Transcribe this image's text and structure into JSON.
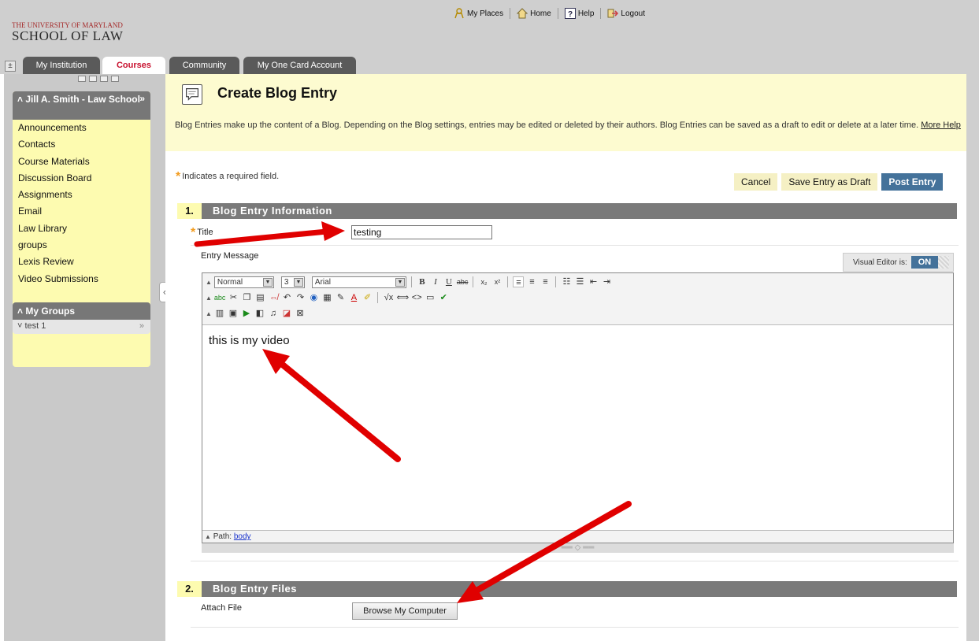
{
  "header": {
    "logo_line1": "THE UNIVERSITY of MARYLAND",
    "logo_line2": "SCHOOL OF LAW",
    "top_links": [
      {
        "label": "My Places",
        "icon": "places-icon"
      },
      {
        "label": "Home",
        "icon": "home-icon"
      },
      {
        "label": "Help",
        "icon": "help-icon"
      },
      {
        "label": "Logout",
        "icon": "logout-icon"
      }
    ],
    "tabs": [
      {
        "label": "My Institution",
        "active": false
      },
      {
        "label": "Courses",
        "active": true
      },
      {
        "label": "Community",
        "active": false
      },
      {
        "label": "My One Card Account",
        "active": false
      }
    ]
  },
  "sidebar": {
    "course_title": "Jill A. Smith - Law School",
    "items": [
      "Announcements",
      "Contacts",
      "Course Materials",
      "Discussion Board",
      "Assignments",
      "Email",
      "Law Library",
      "groups",
      "Lexis Review",
      "Video Submissions"
    ],
    "groups_title": "My Groups",
    "groups": [
      "test 1"
    ]
  },
  "page": {
    "title": "Create Blog Entry",
    "description": "Blog Entries make up the content of a Blog. Depending on the Blog settings, entries may be edited or deleted by their authors. Blog Entries can be saved as a draft to edit or delete at a later time.",
    "help_link": "More Help",
    "required_note": "Indicates a required field.",
    "buttons": {
      "cancel": "Cancel",
      "draft": "Save Entry as Draft",
      "post": "Post Entry"
    }
  },
  "section1": {
    "number": "1.",
    "title": "Blog Entry Information",
    "title_label": "Title",
    "title_value": "testing",
    "entry_label": "Entry Message",
    "visual_editor_label": "Visual Editor is:",
    "visual_editor_state": "ON"
  },
  "editor": {
    "format": "Normal",
    "size": "3",
    "font": "Arial",
    "content": "this is my video",
    "path_label": "Path:",
    "path_value": "body"
  },
  "section2": {
    "number": "2.",
    "title": "Blog Entry Files",
    "attach_label": "Attach File",
    "browse_label": "Browse My Computer"
  },
  "colors": {
    "accent": "#44729a",
    "active_tab": "#c8102e",
    "highlight": "#fdfbb0",
    "annotation": "#e00000"
  }
}
